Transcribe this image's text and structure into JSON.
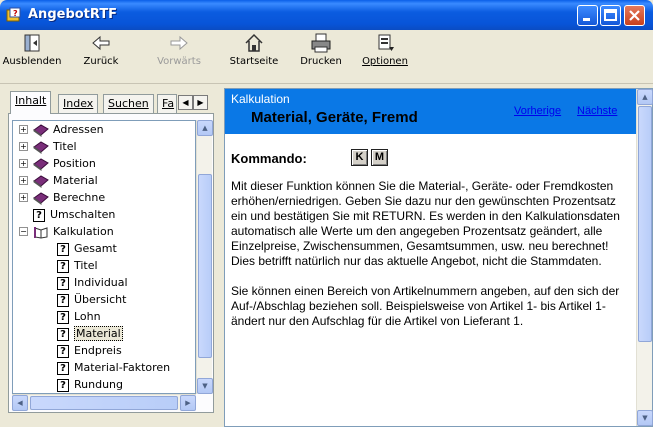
{
  "window": {
    "title": "AngebotRTF"
  },
  "toolbar": {
    "items": [
      {
        "label": "Ausblenden",
        "icon": "hide-icon",
        "disabled": false
      },
      {
        "label": "Zurück",
        "icon": "back-arrow-icon",
        "disabled": false
      },
      {
        "label": "Vorwärts",
        "icon": "forward-arrow-icon",
        "disabled": true
      },
      {
        "label": "Startseite",
        "icon": "home-icon",
        "disabled": false
      },
      {
        "label": "Drucken",
        "icon": "printer-icon",
        "disabled": false
      },
      {
        "label": "Optionen",
        "icon": "options-icon",
        "disabled": false
      }
    ]
  },
  "tabs": [
    "Inhalt",
    "Index",
    "Suchen",
    "Fa"
  ],
  "tree": [
    {
      "label": "Adressen",
      "type": "book",
      "expander": "+",
      "level": 0
    },
    {
      "label": "Titel",
      "type": "book",
      "expander": "+",
      "level": 0
    },
    {
      "label": "Position",
      "type": "book",
      "expander": "+",
      "level": 0
    },
    {
      "label": "Material",
      "type": "book",
      "expander": "+",
      "level": 0
    },
    {
      "label": "Berechne",
      "type": "book",
      "expander": "+",
      "level": 0
    },
    {
      "label": "Umschalten",
      "type": "page",
      "expander": "",
      "level": 0
    },
    {
      "label": "Kalkulation",
      "type": "openbook",
      "expander": "−",
      "level": 0
    },
    {
      "label": "Gesamt",
      "type": "page",
      "expander": "",
      "level": 1
    },
    {
      "label": "Titel",
      "type": "page",
      "expander": "",
      "level": 1
    },
    {
      "label": "Individual",
      "type": "page",
      "expander": "",
      "level": 1
    },
    {
      "label": "Übersicht",
      "type": "page",
      "expander": "",
      "level": 1
    },
    {
      "label": "Lohn",
      "type": "page",
      "expander": "",
      "level": 1
    },
    {
      "label": "Material",
      "type": "page",
      "expander": "",
      "level": 1,
      "selected": true
    },
    {
      "label": "Endpreis",
      "type": "page",
      "expander": "",
      "level": 1
    },
    {
      "label": "Material-Faktoren",
      "type": "page",
      "expander": "",
      "level": 1
    },
    {
      "label": "Rundung",
      "type": "page",
      "expander": "",
      "level": 1
    }
  ],
  "topic": {
    "section": "Kalkulation",
    "title": "Material, Geräte, Fremd",
    "prev_link": "Vorherige",
    "next_link": "Nächste",
    "kommando_label": "Kommando:",
    "keys": [
      "K",
      "M"
    ],
    "paragraphs": [
      "Mit dieser Funktion können Sie die Material-, Geräte- oder Fremdkosten erhöhen/erniedrigen. Geben Sie dazu nur den gewünschten Prozentsatz ein und bestätigen Sie mit RETURN. Es werden in den Kalkulationsdaten automatisch alle Werte um den angegeben Prozentsatz geändert, alle Einzelpreise, Zwischensummen, Gesamtsummen, usw. neu berechnet! Dies betrifft natürlich nur das aktuelle Angebot, nicht die Stammdaten.",
      "Sie können einen Bereich von Artikelnummern angeben, auf den sich der Auf-/Abschlag beziehen soll. Beispielsweise von Artikel 1- bis Artikel 1- ändert nur den Aufschlag für die Artikel von Lieferant 1."
    ]
  },
  "colors": {
    "header_band": "#0a78e6",
    "book": "#7a2e7a",
    "link": "#0000ee"
  }
}
